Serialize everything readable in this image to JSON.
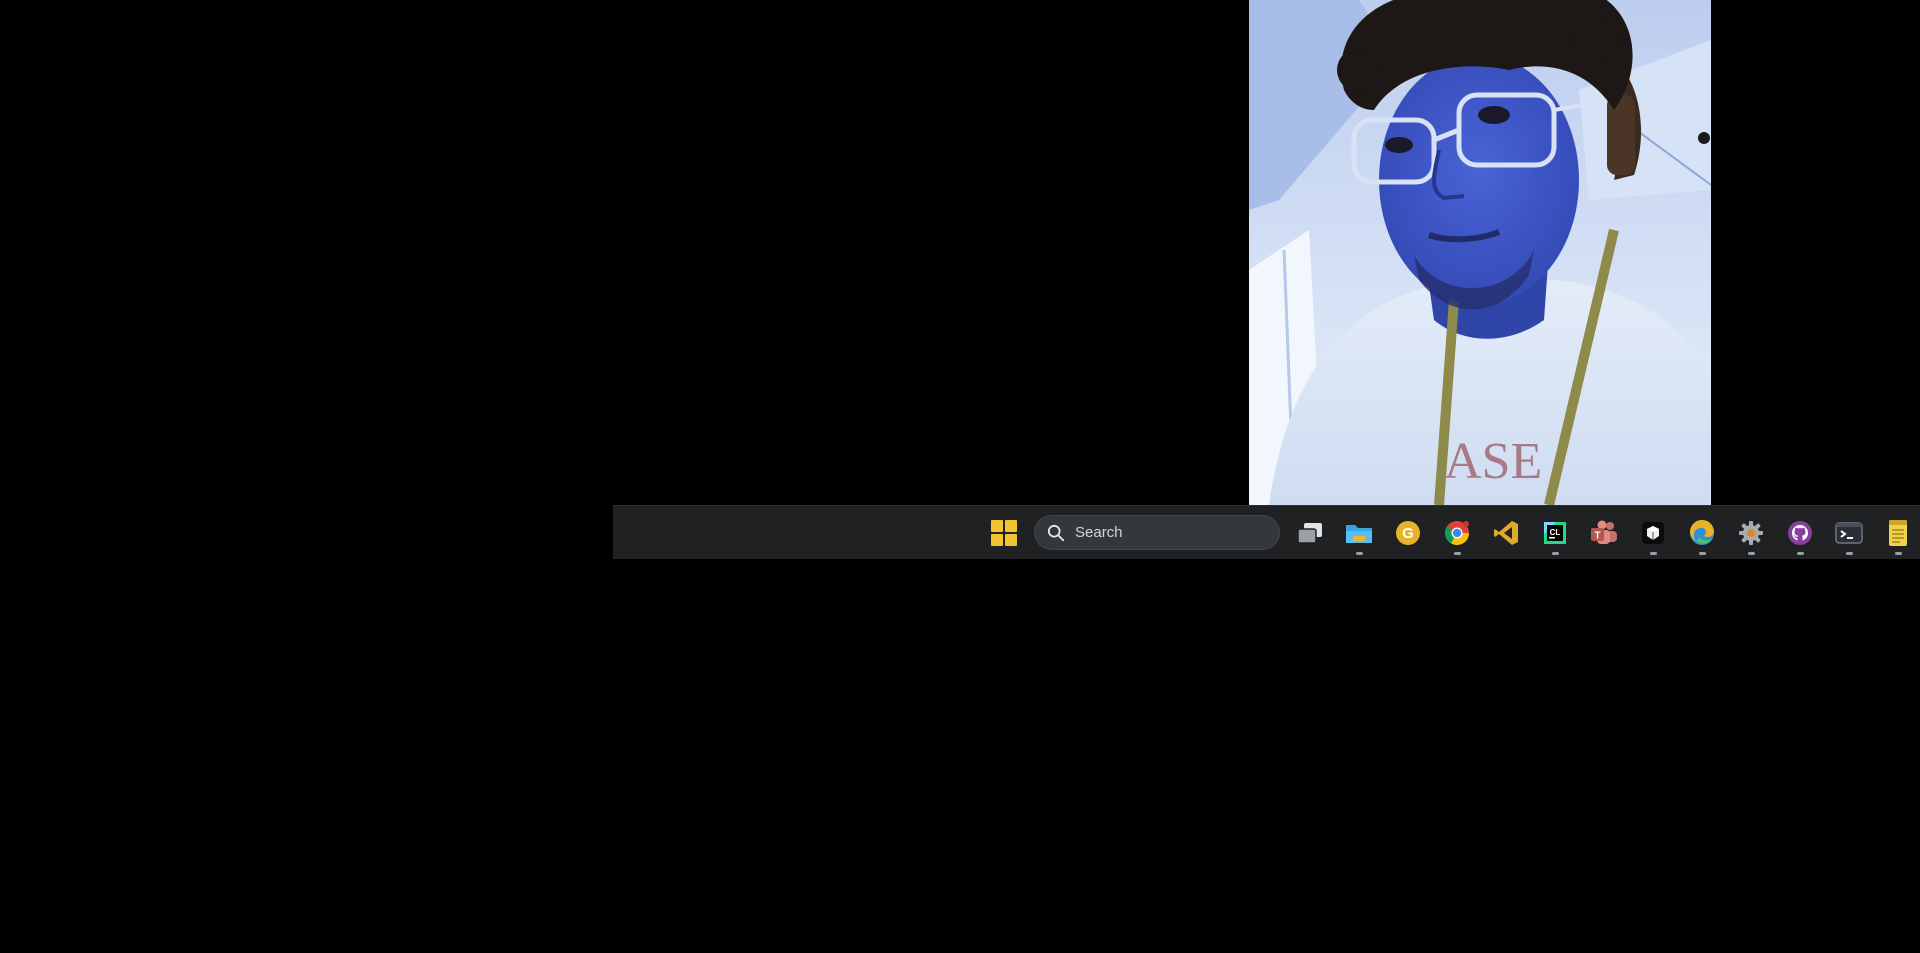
{
  "taskbar": {
    "search_placeholder": "Search",
    "start_icon": "windows-start-icon",
    "pinned_apps": [
      {
        "name": "task-view-icon",
        "running": false
      },
      {
        "name": "file-explorer-icon",
        "running": true
      },
      {
        "name": "google-app-icon",
        "running": false
      },
      {
        "name": "chrome-icon",
        "running": true
      },
      {
        "name": "vscode-icon",
        "running": false
      },
      {
        "name": "clion-icon",
        "running": true
      },
      {
        "name": "teams-icon",
        "running": false
      },
      {
        "name": "packaging-app-icon",
        "running": true
      },
      {
        "name": "edge-icon",
        "running": true
      },
      {
        "name": "settings-icon",
        "running": true
      },
      {
        "name": "github-desktop-icon",
        "running": true
      },
      {
        "name": "terminal-icon",
        "running": true
      },
      {
        "name": "notepad-icon",
        "running": true
      }
    ]
  },
  "webcam": {
    "shirt_text": "ASE"
  },
  "colors": {
    "desktop_background": "#000000",
    "taskbar_background": "#1f2123",
    "accent_yellow": "#f3c431"
  }
}
